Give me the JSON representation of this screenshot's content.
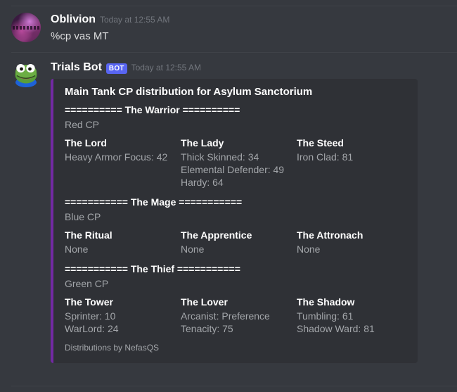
{
  "messages": [
    {
      "author": "Oblivion",
      "is_bot": false,
      "timestamp": "Today at 12:55 AM",
      "content": "%cp vas MT",
      "avatar_icon": "oblivion-nebula-avatar"
    },
    {
      "author": "Trials Bot",
      "is_bot": true,
      "bot_tag": "BOT",
      "timestamp": "Today at 12:55 AM",
      "avatar_icon": "pepe-frog-avatar"
    }
  ],
  "embed": {
    "accent_color": "#7229a3",
    "background_color": "#2f3136",
    "title": "Main Tank CP distribution for Asylum Sanctorium",
    "footer": "Distributions by NefasQS",
    "sections": [
      {
        "heading": "========== The Warrior ==========",
        "description": "Red CP",
        "fields": [
          {
            "name": "The Lord",
            "value": "Heavy Armor Focus: 42"
          },
          {
            "name": "The Lady",
            "value": "Thick Skinned: 34\nElemental Defender: 49\nHardy: 64"
          },
          {
            "name": "The Steed",
            "value": "Iron Clad: 81"
          }
        ]
      },
      {
        "heading": "=========== The Mage ===========",
        "description": "Blue CP",
        "fields": [
          {
            "name": "The Ritual",
            "value": "None"
          },
          {
            "name": "The Apprentice",
            "value": "None"
          },
          {
            "name": "The Attronach",
            "value": "None"
          }
        ]
      },
      {
        "heading": "=========== The Thief ===========",
        "description": "Green CP",
        "fields": [
          {
            "name": "The Tower",
            "value": "Sprinter: 10\nWarLord: 24"
          },
          {
            "name": "The Lover",
            "value": "Arcanist: Preference\nTenacity: 75"
          },
          {
            "name": "The Shadow",
            "value": "Tumbling: 61\nShadow Ward: 81"
          }
        ]
      }
    ]
  }
}
